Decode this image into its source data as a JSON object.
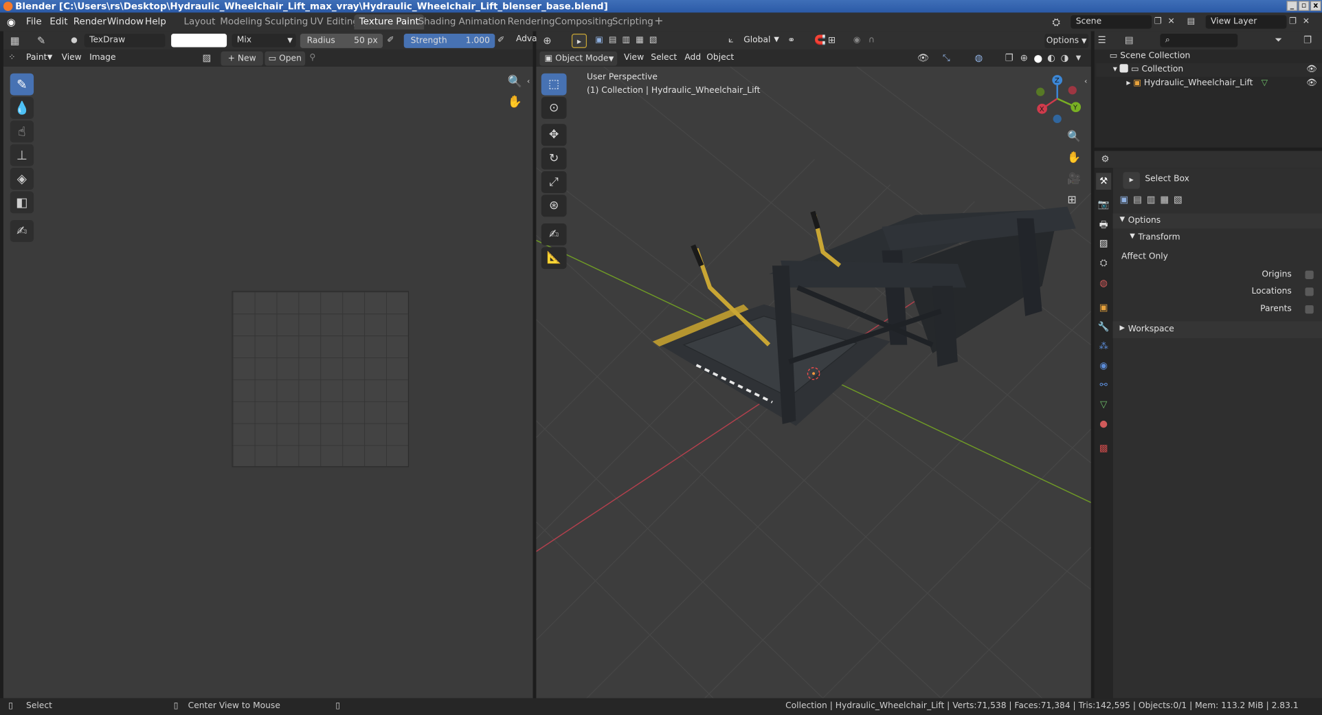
{
  "window": {
    "title": "Blender [C:\\Users\\rs\\Desktop\\Hydraulic_Wheelchair_Lift_max_vray\\Hydraulic_Wheelchair_Lift_blenser_base.blend]",
    "buttons": [
      "_",
      "▫",
      "x"
    ]
  },
  "menu": {
    "items": [
      "File",
      "Edit",
      "Render",
      "Window",
      "Help"
    ]
  },
  "workspaces": {
    "tabs": [
      "Layout",
      "Modeling",
      "Sculpting",
      "UV Editing",
      "Texture Paint",
      "Shading",
      "Animation",
      "Rendering",
      "Compositing",
      "Scripting"
    ],
    "active": "Texture Paint",
    "add": "+"
  },
  "scene": {
    "scene_name": "Scene",
    "view_layer": "View Layer"
  },
  "image_editor": {
    "brush_name": "TexDraw",
    "blend_mode": "Mix",
    "radius_label": "Radius",
    "radius_value": "50 px",
    "strength_label": "Strength",
    "strength_value": "1.000",
    "adv_label": "Adva",
    "mode_menu": "Paint",
    "view_menu": "View",
    "image_menu": "Image",
    "new_label": "New",
    "open_label": "Open",
    "color_swatch": "#ffffff"
  },
  "viewport": {
    "orientation_label": "Global",
    "options_label": "Options",
    "mode_label": "Object Mode",
    "menus": [
      "View",
      "Select",
      "Add",
      "Object"
    ],
    "perspective_label": "User Perspective",
    "object_path": "(1) Collection | Hydraulic_Wheelchair_Lift",
    "axes": {
      "x": "X",
      "y": "Y",
      "z": "Z"
    },
    "axis_colors": {
      "x": "#d03b4c",
      "y": "#79b023",
      "z": "#3c87d6"
    }
  },
  "outliner": {
    "root": "Scene Collection",
    "collection": "Collection",
    "object": "Hydraulic_Wheelchair_Lift"
  },
  "properties": {
    "tool_name": "Select Box",
    "options_label": "Options",
    "transform_label": "Transform",
    "affect_only_label": "Affect Only",
    "origins_label": "Origins",
    "locations_label": "Locations",
    "parents_label": "Parents",
    "workspace_label": "Workspace"
  },
  "status": {
    "select_label": "Select",
    "center_label": "Center View to Mouse",
    "stats": "Collection | Hydraulic_Wheelchair_Lift | Verts:71,538 | Faces:71,384 | Tris:142,595 | Objects:0/1 | Mem: 113.2 MiB | 2.83.1"
  },
  "colors": {
    "accent": "#4772b3",
    "title_bar": "#2f5da8",
    "lift_frame": "#2b2f34",
    "lift_handle": "#c9a634"
  }
}
